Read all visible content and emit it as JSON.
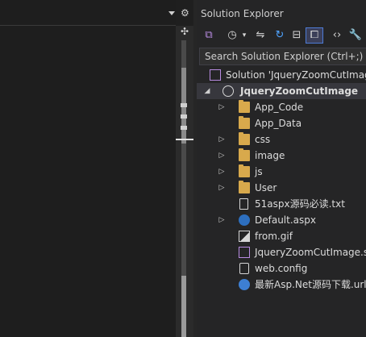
{
  "panel": {
    "title": "Solution Explorer",
    "search_placeholder": "Search Solution Explorer (Ctrl+;)"
  },
  "toolbar_icons": [
    "vs-switch-views-icon",
    "history-icon",
    "dropdown-icon",
    "sync-icon",
    "refresh-icon",
    "collapse-all-icon",
    "show-all-files-icon",
    "code-icon",
    "wrench-icon"
  ],
  "tree": {
    "solution": "Solution 'JqueryZoomCutImage'",
    "project": "JqueryZoomCutImage",
    "items": [
      {
        "label": "App_Code",
        "type": "folder",
        "expandable": true
      },
      {
        "label": "App_Data",
        "type": "folder",
        "expandable": false
      },
      {
        "label": "css",
        "type": "folder",
        "expandable": true
      },
      {
        "label": "image",
        "type": "folder",
        "expandable": true
      },
      {
        "label": "js",
        "type": "folder",
        "expandable": true
      },
      {
        "label": "User",
        "type": "folder",
        "expandable": true
      },
      {
        "label": "51aspx源码必读.txt",
        "type": "file",
        "expandable": false
      },
      {
        "label": "Default.aspx",
        "type": "aspx",
        "expandable": true
      },
      {
        "label": "from.gif",
        "type": "image",
        "expandable": false
      },
      {
        "label": "JqueryZoomCutImage.sln",
        "type": "solution",
        "expandable": false
      },
      {
        "label": "web.config",
        "type": "config",
        "expandable": false
      },
      {
        "label": "最新Asp.Net源码下载.url",
        "type": "url",
        "expandable": false
      }
    ]
  },
  "colors": {
    "accent": "#4d7bd6",
    "folder": "#d8a94c",
    "selection": "#37373d"
  }
}
